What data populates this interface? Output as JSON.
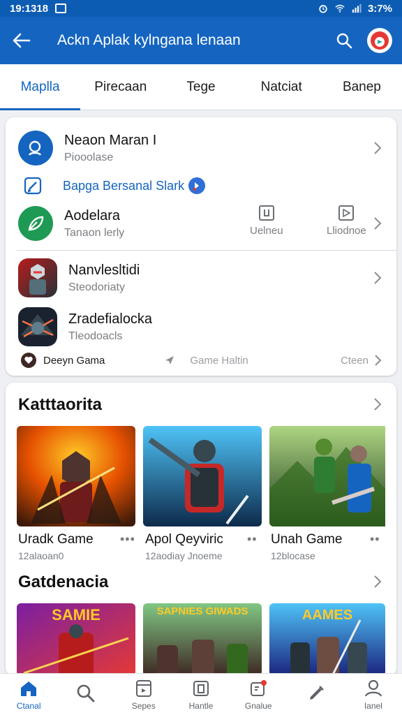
{
  "status_bar": {
    "time": "19:1318",
    "battery": "3:7%"
  },
  "app_bar": {
    "title": "Ackn Aplak kylngana lenaan"
  },
  "tabs": [
    {
      "label": "Maplla",
      "active": true
    },
    {
      "label": "Pirecaan",
      "active": false
    },
    {
      "label": "Tege",
      "active": false
    },
    {
      "label": "Natciat",
      "active": false
    },
    {
      "label": "Banep",
      "active": false
    }
  ],
  "account": {
    "name": "Neaon Maran I",
    "subtitle": "Piooolase"
  },
  "badge_link": {
    "label": "Bapga Bersanal Slark"
  },
  "app_row": {
    "name": "Aodelara",
    "subtitle": "Tanaon lerly",
    "action1": "Uelneu",
    "action2": "Lliodnoe"
  },
  "games_list": [
    {
      "name": "Nanvlesltidi",
      "subtitle": "Steodoriaty"
    },
    {
      "name": "Zradefialocka",
      "subtitle": "Tleodoacls"
    }
  ],
  "footer": {
    "left": "Deeyn Gama",
    "center": "Game Haltin",
    "right": "Cteen"
  },
  "section1": {
    "title": "Katttaorita",
    "items": [
      {
        "title": "Uradk Game",
        "sub": "12alaoan0"
      },
      {
        "title": "Apol Qeyviric",
        "sub": "12aodiay Jnoeme"
      },
      {
        "title": "Unah Game",
        "sub": "12blocase"
      }
    ]
  },
  "section2": {
    "title": "Gatdenacia",
    "banners": [
      "SAMIE",
      "SAPNIES GIWADS",
      "AAMES"
    ]
  },
  "bottom_nav": [
    {
      "label": "Ctanal",
      "icon": "home-icon",
      "active": true
    },
    {
      "label": "",
      "icon": "search-icon",
      "active": false
    },
    {
      "label": "Sepes",
      "icon": "store-icon",
      "active": false
    },
    {
      "label": "Hantle",
      "icon": "library-icon",
      "active": false
    },
    {
      "label": "Gnalue",
      "icon": "notifications-icon",
      "active": false
    },
    {
      "label": "",
      "icon": "pen-icon",
      "active": false
    },
    {
      "label": "Ianel",
      "icon": "profile-icon",
      "active": false
    }
  ],
  "colors": {
    "primary": "#1565c0",
    "background": "#eef0f3"
  }
}
